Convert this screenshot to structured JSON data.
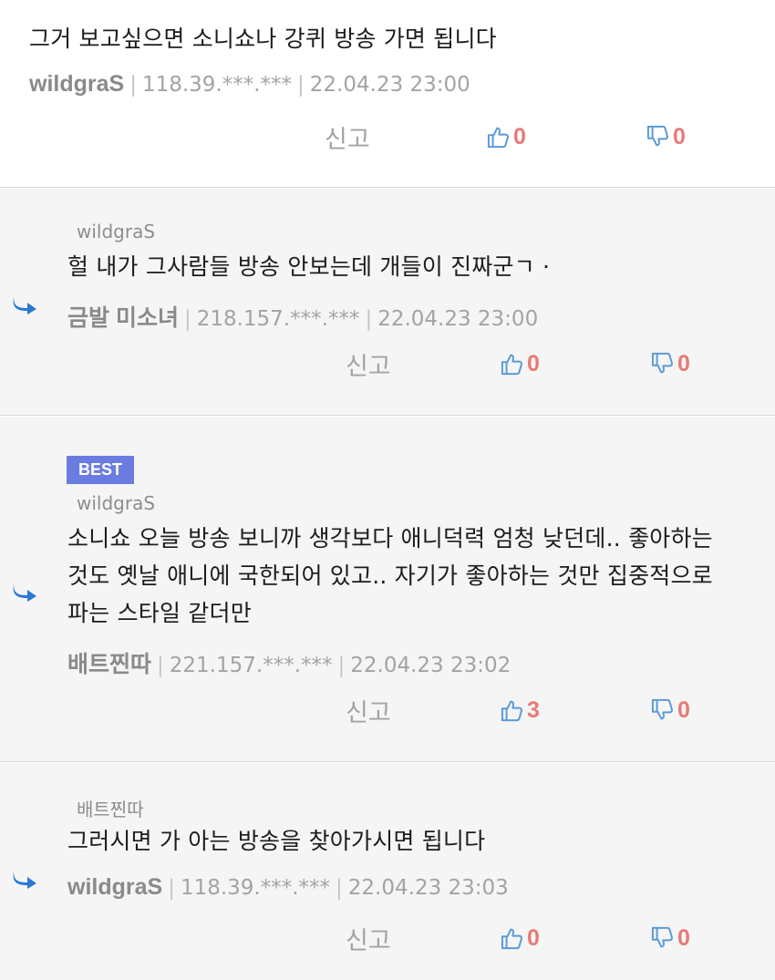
{
  "colors": {
    "like_icon": "#5b9ad8",
    "count": "#e87a74",
    "best_badge": "#6b7ce0",
    "reply_arrow": "#2a78d0"
  },
  "comments": [
    {
      "text": "그거 보고싶으면 소니쇼나 강퀴 방송 가면 됩니다",
      "nick": "wildgraS",
      "ip": "118.39.***.***",
      "date": "22.04.23 23:00",
      "report": "신고",
      "likes": "0",
      "dislikes": "0"
    },
    {
      "reply_to": "wildgraS",
      "text": "헐 내가 그사람들 방송 안보는데 개들이 진짜군ㄱ ·",
      "nick": "금발 미소녀",
      "ip": "218.157.***.***",
      "date": "22.04.23 23:00",
      "report": "신고",
      "likes": "0",
      "dislikes": "0"
    },
    {
      "badge": "BEST",
      "reply_to": "wildgraS",
      "text_lines": [
        "소니쇼 오늘 방송 보니까 생각보다 애니덕력 엄청 낮던데.. 좋아하는",
        "것도 옛날 애니에 국한되어 있고.. 자기가 좋아하는 것만 집중적으로",
        "파는 스타일 같더만"
      ],
      "nick": "배트찐따",
      "ip": "221.157.***.***",
      "date": "22.04.23 23:02",
      "report": "신고",
      "likes": "3",
      "dislikes": "0"
    },
    {
      "reply_to": "배트찐따",
      "text": "그러시면 가 아는 방송을 찾아가시면 됩니다",
      "nick": "wildgraS",
      "ip": "118.39.***.***",
      "date": "22.04.23 23:03",
      "report": "신고",
      "likes": "0",
      "dislikes": "0"
    }
  ]
}
